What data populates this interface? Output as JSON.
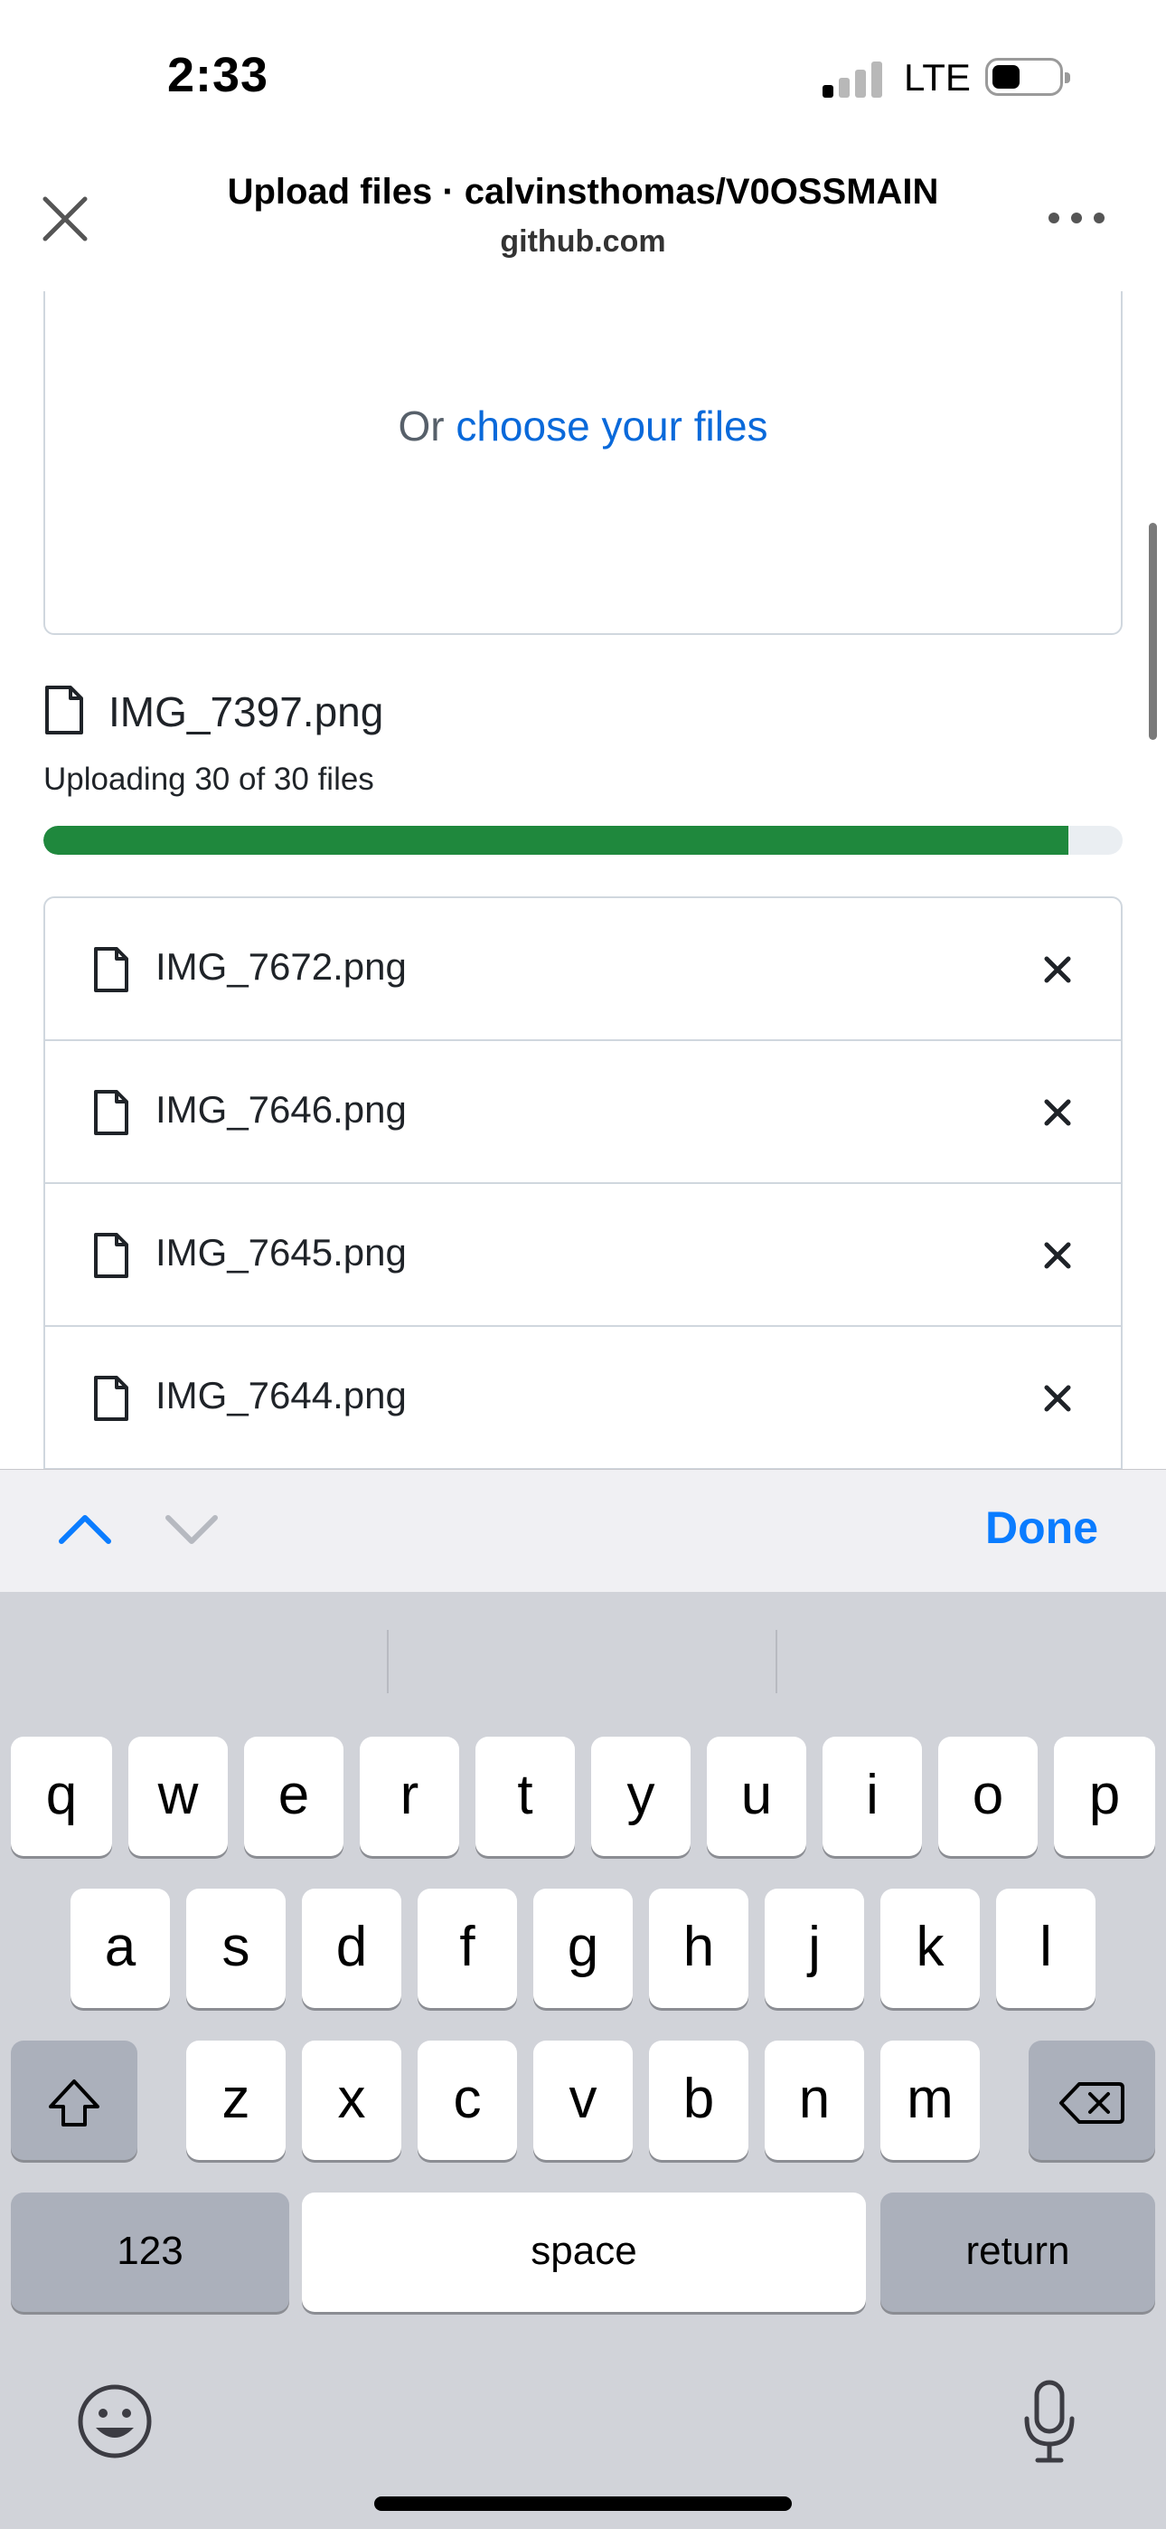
{
  "status_bar": {
    "time": "2:33",
    "network": "LTE",
    "signal_bars_active": 1,
    "signal_bars_total": 4
  },
  "browser": {
    "title": "Upload files · calvinsthomas/V0OSSMAIN",
    "domain": "github.com"
  },
  "dropzone": {
    "prefix": "Or",
    "link": "choose your files"
  },
  "upload": {
    "current_file": "IMG_7397.png",
    "status_text": "Uploading 30 of 30 files",
    "progress_percent": 95
  },
  "files": [
    {
      "name": "IMG_7672.png"
    },
    {
      "name": "IMG_7646.png"
    },
    {
      "name": "IMG_7645.png"
    },
    {
      "name": "IMG_7644.png"
    }
  ],
  "accessory": {
    "done_label": "Done"
  },
  "keyboard": {
    "row1": [
      "q",
      "w",
      "e",
      "r",
      "t",
      "y",
      "u",
      "i",
      "o",
      "p"
    ],
    "row2": [
      "a",
      "s",
      "d",
      "f",
      "g",
      "h",
      "j",
      "k",
      "l"
    ],
    "row3": [
      "z",
      "x",
      "c",
      "v",
      "b",
      "n",
      "m"
    ],
    "numbers_label": "123",
    "space_label": "space",
    "return_label": "return"
  },
  "colors": {
    "accent": "#0969da",
    "progress": "#1f883d",
    "done": "#0a7cff"
  }
}
